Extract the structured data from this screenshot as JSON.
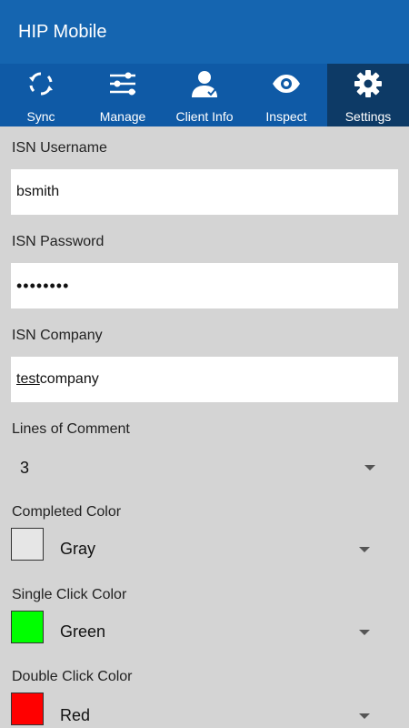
{
  "app": {
    "title": "HIP Mobile"
  },
  "tabs": [
    {
      "label": "Sync",
      "icon": "sync-icon"
    },
    {
      "label": "Manage",
      "icon": "sliders-icon"
    },
    {
      "label": "Client Info",
      "icon": "person-icon"
    },
    {
      "label": "Inspect",
      "icon": "eye-icon"
    },
    {
      "label": "Settings",
      "icon": "gear-icon",
      "active": true
    }
  ],
  "settings": {
    "username_label": "ISN Username",
    "username_value": "bsmith",
    "password_label": "ISN Password",
    "password_value": "••••••••",
    "company_label": "ISN Company",
    "company_value_underlined": "test",
    "company_value_rest": "company",
    "lines_label": "Lines of Comment",
    "lines_value": "3",
    "completed_label": "Completed Color",
    "completed_value": "Gray",
    "completed_swatch": "#e6e6e6",
    "single_label": "Single Click Color",
    "single_value": "Green",
    "single_swatch": "#00ff00",
    "double_label": "Double Click Color",
    "double_value": "Red",
    "double_swatch": "#ff0000"
  },
  "colors": {
    "appbar": "#1565b0",
    "tabbar": "#0f5aa6",
    "tab_active": "#0d3a66",
    "background": "#d4d4d4"
  }
}
